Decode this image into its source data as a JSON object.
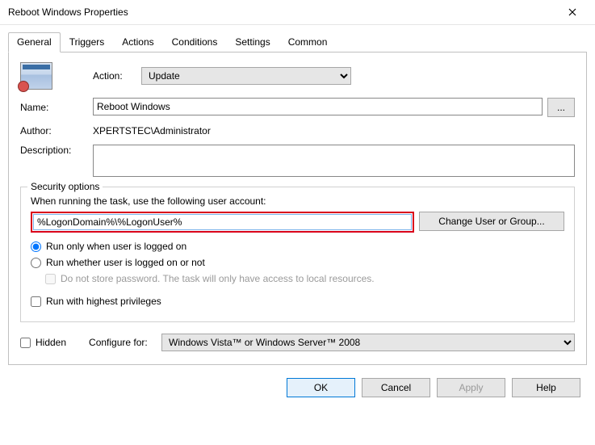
{
  "window": {
    "title": "Reboot Windows Properties"
  },
  "tabs": [
    "General",
    "Triggers",
    "Actions",
    "Conditions",
    "Settings",
    "Common"
  ],
  "general": {
    "action_label": "Action:",
    "action_value": "Update",
    "name_label": "Name:",
    "name_value": "Reboot Windows",
    "browse_label": "...",
    "author_label": "Author:",
    "author_value": "XPERTSTEC\\Administrator",
    "description_label": "Description:",
    "description_value": ""
  },
  "security": {
    "legend": "Security options",
    "prompt": "When running the task, use the following user account:",
    "account_value": "%LogonDomain%\\%LogonUser%",
    "change_button": "Change User or Group...",
    "radio_logged_on": "Run only when user is logged on",
    "radio_whether": "Run whether user is logged on or not",
    "no_store_password": "Do not store password. The task will only have access to local resources.",
    "highest_priv": "Run with highest privileges"
  },
  "bottom": {
    "hidden_label": "Hidden",
    "configure_label": "Configure for:",
    "configure_value": "Windows Vista™ or Windows Server™ 2008"
  },
  "footer": {
    "ok": "OK",
    "cancel": "Cancel",
    "apply": "Apply",
    "help": "Help"
  }
}
